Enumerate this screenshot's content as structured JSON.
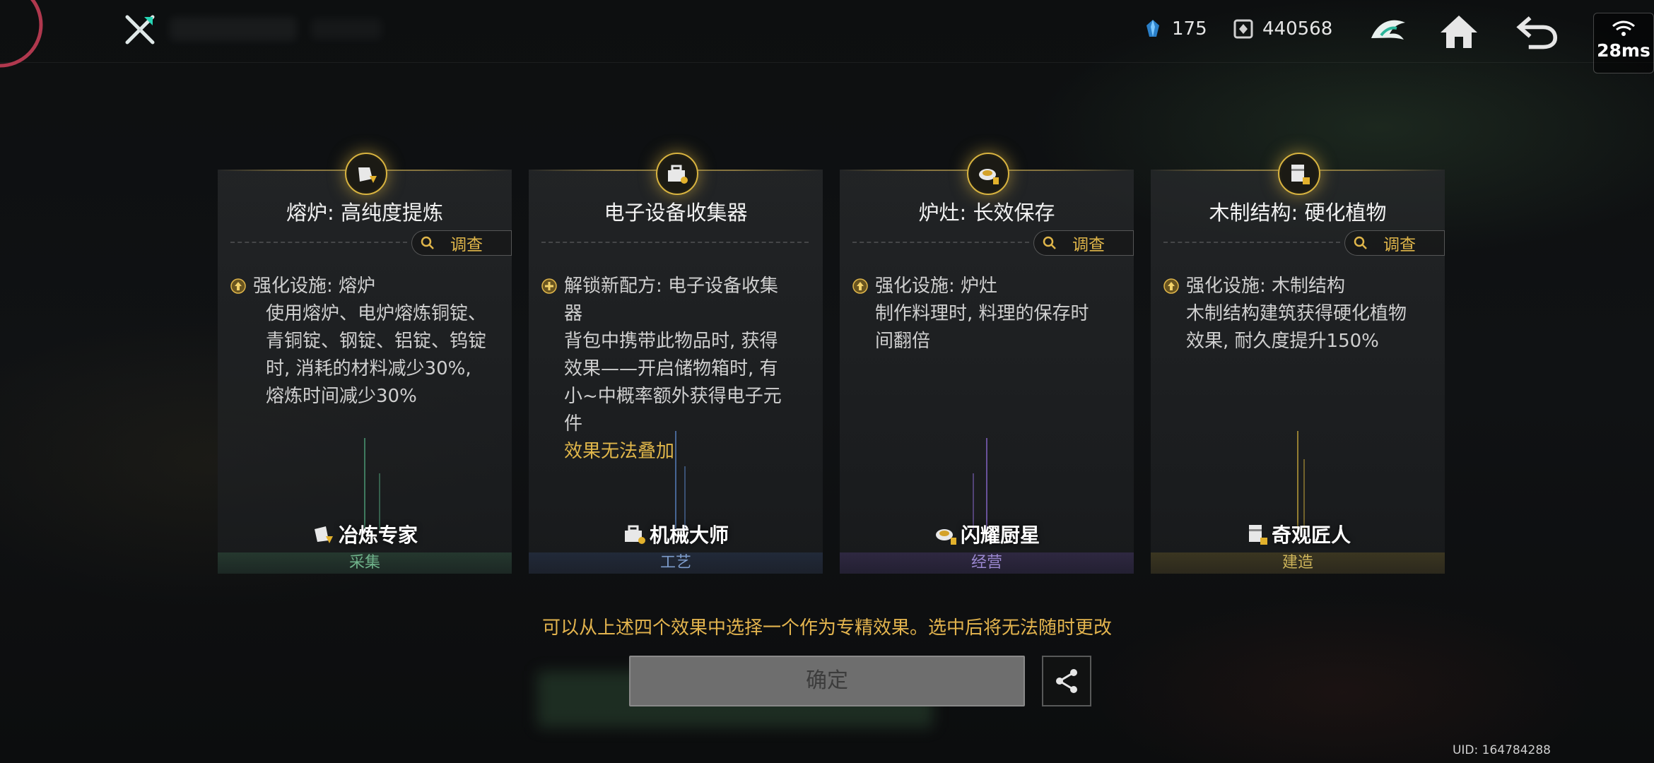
{
  "topbar": {
    "resources": [
      {
        "icon": "crystal-icon",
        "value": "175"
      },
      {
        "icon": "coin-box-icon",
        "value": "440568"
      }
    ],
    "network": {
      "latency": "28ms"
    }
  },
  "cards": [
    {
      "title": "熔炉: 高纯度提炼",
      "inspect_label": "调查",
      "line1": "强化设施: 熔炉",
      "desc": [
        "使用熔炉、电炉熔炼铜锭、",
        "青铜锭、钢锭、铝锭、钨锭",
        "时, 消耗的材料减少30%,",
        "熔炼时间减少30%"
      ],
      "warn": "",
      "role": "冶炼专家",
      "category": "采集",
      "accent": "#4fa27a"
    },
    {
      "title": "电子设备收集器",
      "inspect_label": "",
      "line1": "解锁新配方: 电子设备收集",
      "desc": [
        "器",
        "背包中携带此物品时, 获得",
        "效果——开启储物箱时, 有",
        "小~中概率额外获得电子元",
        "件"
      ],
      "warn": "效果无法叠加",
      "role": "机械大师",
      "category": "工艺",
      "accent": "#5a86c8"
    },
    {
      "title": "炉灶: 长效保存",
      "inspect_label": "调查",
      "line1": "强化设施: 炉灶",
      "desc": [
        "制作料理时, 料理的保存时",
        "间翻倍"
      ],
      "warn": "",
      "role": "闪耀厨星",
      "category": "经营",
      "accent": "#8a6ad0"
    },
    {
      "title": "木制结构: 硬化植物",
      "inspect_label": "调查",
      "line1": "强化设施: 木制结构",
      "desc": [
        "木制结构建筑获得硬化植物",
        "效果, 耐久度提升150%"
      ],
      "warn": "",
      "role": "奇观匠人",
      "category": "建造",
      "accent": "#c8a83a"
    }
  ],
  "notice": "可以从上述四个效果中选择一个作为专精效果。选中后将无法随时更改",
  "confirm_label": "确定",
  "uid": "UID: 164784288"
}
